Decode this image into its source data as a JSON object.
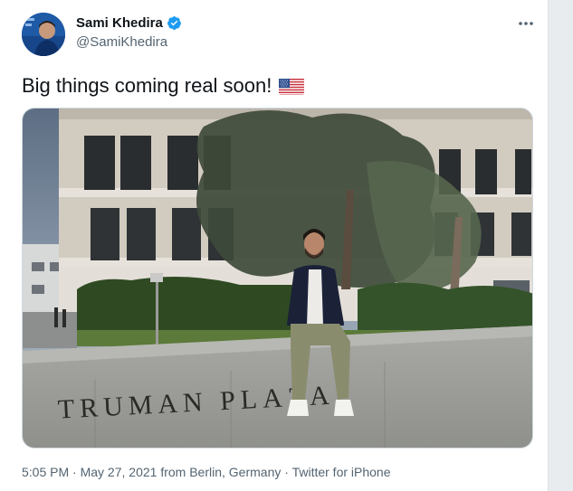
{
  "tweet": {
    "author_name": "Sami Khedira",
    "author_handle": "@SamiKhedira",
    "text": "Big things coming real soon!",
    "emoji": "us-flag-emoji",
    "photo_sign_text": "TRUMAN PLAZA",
    "meta": {
      "time": "5:05 PM",
      "separator1": " · ",
      "date": "May 27, 2021 from Berlin, Germany",
      "separator2": " · ",
      "source": "Twitter for iPhone"
    }
  },
  "colors": {
    "verified": "#1d9bf0",
    "text_primary": "#0f1419",
    "text_secondary": "#536471"
  },
  "icons": {
    "verified": "verified-badge-icon",
    "more": "more-dots-icon"
  }
}
